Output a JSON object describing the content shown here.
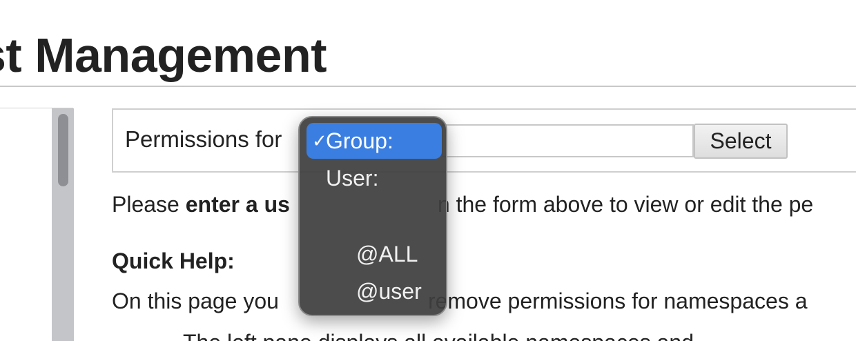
{
  "page": {
    "title": "st Management"
  },
  "form": {
    "label": "Permissions for",
    "select_label": "Select"
  },
  "dropdown": {
    "items": [
      {
        "label": "Group:",
        "selected": true
      },
      {
        "label": "User:",
        "selected": false
      },
      {
        "label": "@ALL",
        "selected": false
      },
      {
        "label": "@user",
        "selected": false
      }
    ],
    "check_glyph": "✓"
  },
  "content": {
    "instruction_pre": "Please ",
    "instruction_bold": "enter a us",
    "instruction_post": "n the form above to view or edit the pe",
    "help_heading": "Quick Help:",
    "help_text_pre": "On this page you",
    "help_text_post": "remove permissions for namespaces a",
    "list_line": "The left pane displays all available namespaces and"
  }
}
